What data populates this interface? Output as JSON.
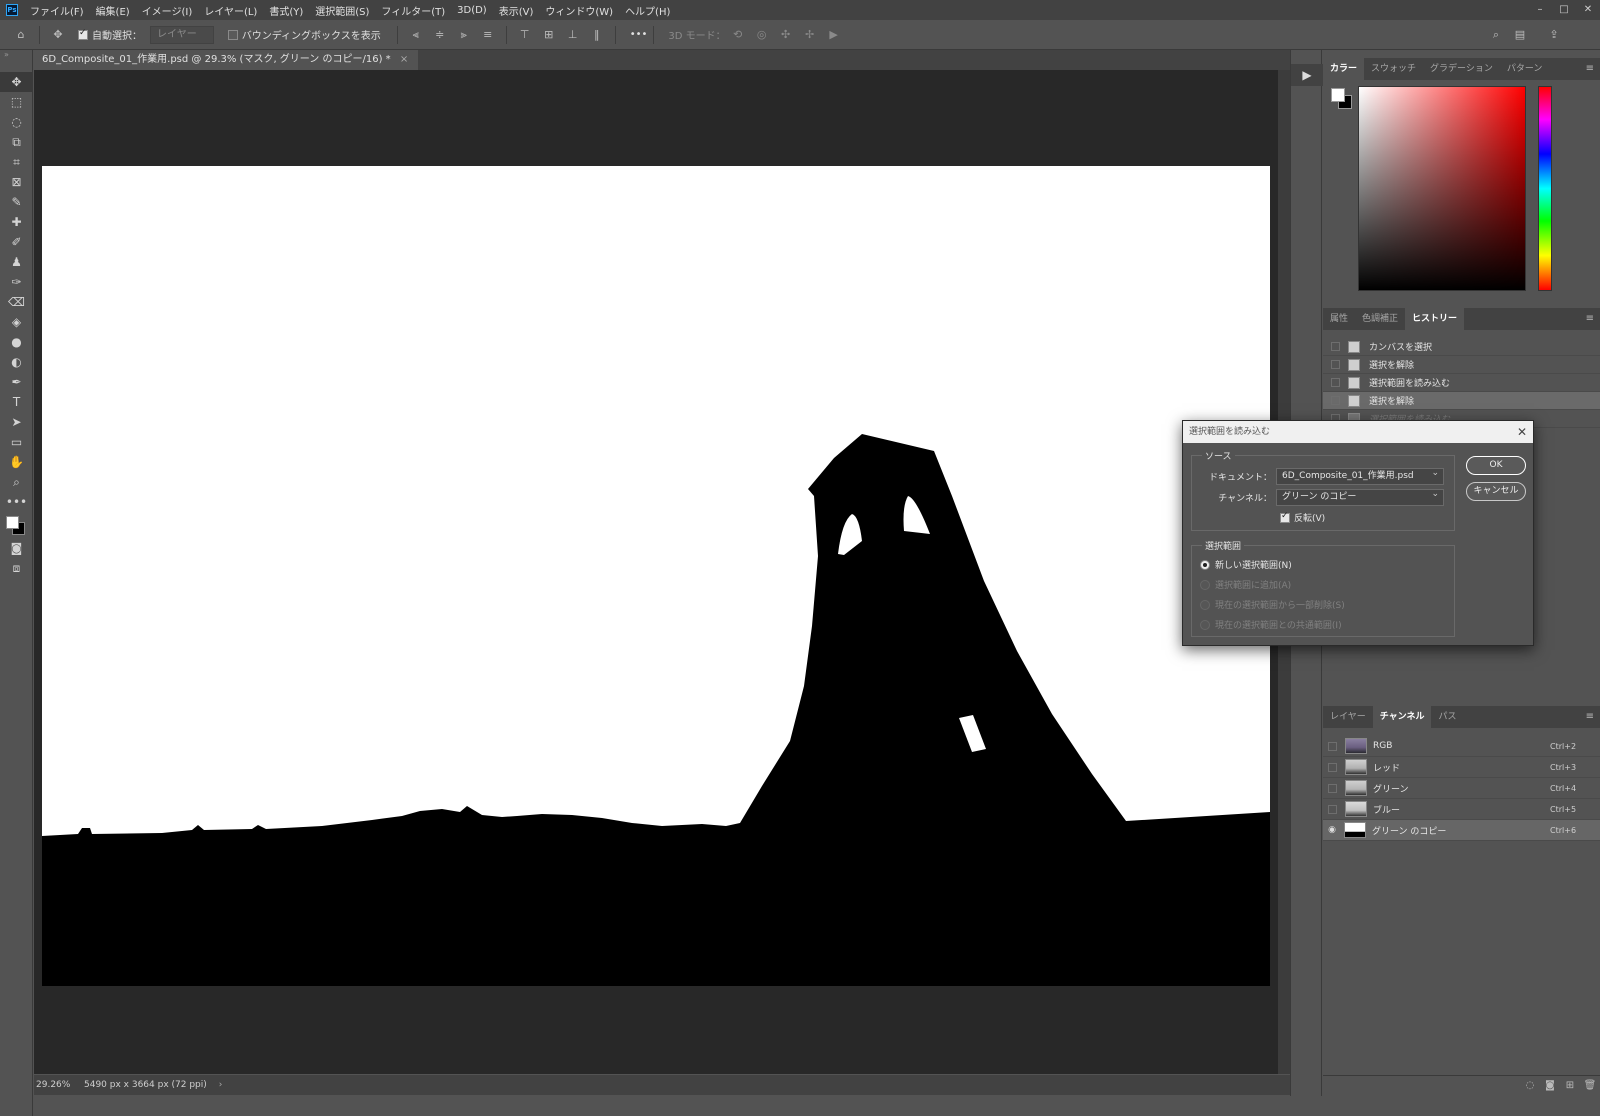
{
  "menubar": {
    "logo": "Ps",
    "items": [
      "ファイル(F)",
      "編集(E)",
      "イメージ(I)",
      "レイヤー(L)",
      "書式(Y)",
      "選択範囲(S)",
      "フィルター(T)",
      "3D(D)",
      "表示(V)",
      "ウィンドウ(W)",
      "ヘルプ(H)"
    ],
    "window_controls": [
      "–",
      "□",
      "✕"
    ]
  },
  "options": {
    "auto_select_label": "自動選択：",
    "auto_select_checked": true,
    "auto_select_target": "レイヤー",
    "bounding_box_label": "バウンディングボックスを表示",
    "bounding_box_checked": false,
    "more": "•••",
    "mode_3d_label": "3D モード："
  },
  "document": {
    "tab_title": "6D_Composite_01_作業用.psd @ 29.3% (マスク, グリーン のコピー/16) *",
    "tab_close": "×",
    "zoom": "29.26%",
    "dimensions": "5490 px x 3664 px (72 ppi)",
    "status_arrow": "›"
  },
  "panels": {
    "color": {
      "tabs": [
        "カラー",
        "スウォッチ",
        "グラデーション",
        "パターン"
      ],
      "active_tab": "カラー",
      "foreground": "#ffffff",
      "background": "#000000"
    },
    "history": {
      "tabs": [
        "属性",
        "色調補正",
        "ヒストリー"
      ],
      "active_tab": "ヒストリー",
      "items": [
        {
          "label": "カンバスを選択",
          "state": "normal"
        },
        {
          "label": "選択を解除",
          "state": "normal"
        },
        {
          "label": "選択範囲を読み込む",
          "state": "normal"
        },
        {
          "label": "選択を解除",
          "state": "selected"
        },
        {
          "label": "選択範囲を読み込む",
          "state": "undone"
        }
      ]
    },
    "channels": {
      "tabs": [
        "レイヤー",
        "チャンネル",
        "パス"
      ],
      "active_tab": "チャンネル",
      "rows": [
        {
          "name": "RGB",
          "shortcut": "Ctrl+2",
          "visible": false,
          "selected": false
        },
        {
          "name": "レッド",
          "shortcut": "Ctrl+3",
          "visible": false,
          "selected": false
        },
        {
          "name": "グリーン",
          "shortcut": "Ctrl+4",
          "visible": false,
          "selected": false
        },
        {
          "name": "ブルー",
          "shortcut": "Ctrl+5",
          "visible": false,
          "selected": false
        },
        {
          "name": "グリーン のコピー",
          "shortcut": "Ctrl+6",
          "visible": true,
          "selected": true
        }
      ]
    }
  },
  "dialog": {
    "title": "選択範囲を読み込む",
    "source_legend": "ソース",
    "document_label": "ドキュメント：",
    "document_value": "6D_Composite_01_作業用.psd",
    "channel_label": "チャンネル：",
    "channel_value": "グリーン のコピー",
    "invert_label": "反転(V)",
    "invert_checked": true,
    "operation_legend": "選択範囲",
    "operations": [
      {
        "label": "新しい選択範囲(N)",
        "selected": true,
        "enabled": true
      },
      {
        "label": "選択範囲に追加(A)",
        "selected": false,
        "enabled": false
      },
      {
        "label": "現在の選択範囲から一部削除(S)",
        "selected": false,
        "enabled": false
      },
      {
        "label": "現在の選択範囲との共通範囲(I)",
        "selected": false,
        "enabled": false
      }
    ],
    "ok_label": "OK",
    "cancel_label": "キャンセル"
  },
  "toolbar": {
    "tools": [
      "move-tool",
      "marquee-tool",
      "lasso-tool",
      "object-select-tool",
      "crop-tool",
      "frame-tool",
      "eyedropper-tool",
      "healing-brush-tool",
      "brush-tool",
      "clone-stamp-tool",
      "history-brush-tool",
      "eraser-tool",
      "paint-bucket-tool",
      "blur-tool",
      "dodge-tool",
      "pen-tool",
      "type-tool",
      "path-select-tool",
      "rectangle-tool",
      "hand-tool",
      "zoom-tool",
      "more-tools"
    ],
    "glyphs": [
      "✥",
      "⬚",
      "◌",
      "⧉",
      "⌗",
      "⊠",
      "✎",
      "✚",
      "✐",
      "♟",
      "✑",
      "⌫",
      "◈",
      "●",
      "◐",
      "✒",
      "T",
      "➤",
      "▭",
      "✋",
      "⌕",
      "•••"
    ]
  },
  "colors": {
    "accent": "#31a8ff",
    "ui_dark": "#535353",
    "canvas_bg": "#282828"
  }
}
